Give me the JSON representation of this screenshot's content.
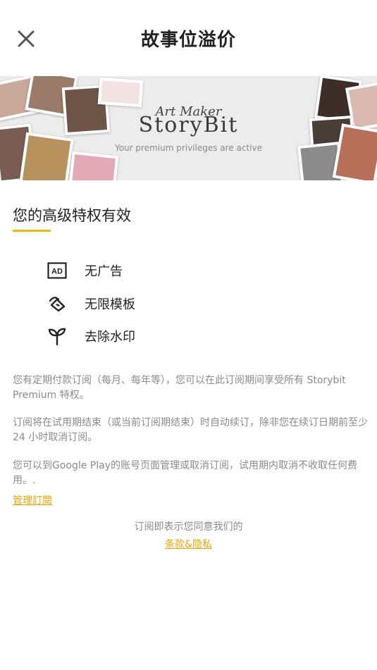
{
  "header": {
    "title": "故事位溢价",
    "close_icon": "close-icon"
  },
  "banner": {
    "script_text": "Art Maker",
    "logo_text": "StoryBit",
    "tagline": "Your premium privileges are active"
  },
  "section": {
    "title": "您的高级特权有效",
    "accent_color": "#f5b800"
  },
  "features": [
    {
      "icon": "ad-icon",
      "label": "无广告"
    },
    {
      "icon": "template-icon",
      "label": "无限模板"
    },
    {
      "icon": "sprout-icon",
      "label": "去除水印"
    }
  ],
  "info": {
    "paragraph1": "您有定期付款订阅（每月、每年等），您可以在此订阅期间享受所有 Storybit Premium 特权。",
    "paragraph2": "订阅将在试用期结束（或当前订阅期结束）时自动续订，除非您在续订日期前至少 24 小时取消订阅。",
    "paragraph3": "您可以到Google Play的账号页面管理或取消订阅，试用期内取消不收取任何费用。."
  },
  "links": {
    "manage": "管理訂閱",
    "agree_text": "订阅即表示您同意我们的",
    "terms": "条款&隐私",
    "link_color": "#f0a400"
  }
}
